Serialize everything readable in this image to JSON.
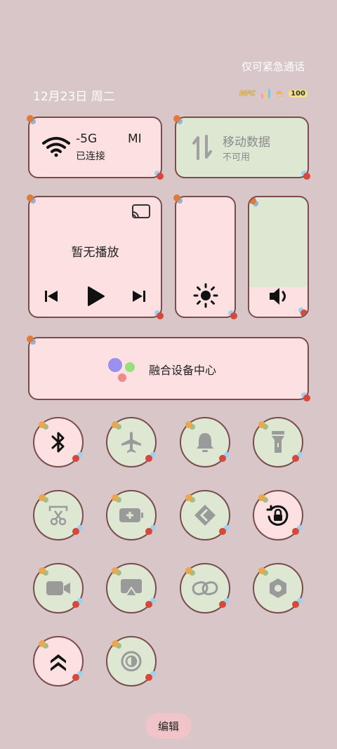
{
  "header": {
    "emergency_note": "仅可紧急通话",
    "date": "12月23日 周二",
    "nfc": "NFC",
    "battery": "100"
  },
  "tiles": {
    "wifi": {
      "name_part1": "-5G",
      "name_part2": "MI",
      "status": "已连接"
    },
    "mobile_data": {
      "title": "移动数据",
      "status": "不可用"
    },
    "media": {
      "title": "暂无播放"
    },
    "device_center": {
      "label": "融合设备中心"
    }
  },
  "toggles": [
    {
      "name": "bluetooth",
      "state": "on"
    },
    {
      "name": "airplane",
      "state": "off"
    },
    {
      "name": "bell",
      "state": "off"
    },
    {
      "name": "flashlight",
      "state": "off"
    },
    {
      "name": "screenshot",
      "state": "off"
    },
    {
      "name": "battery-saver",
      "state": "off"
    },
    {
      "name": "share",
      "state": "off"
    },
    {
      "name": "rotation-lock",
      "state": "on"
    },
    {
      "name": "screen-record",
      "state": "off"
    },
    {
      "name": "cast",
      "state": "off"
    },
    {
      "name": "link",
      "state": "off"
    },
    {
      "name": "settings-hex",
      "state": "off"
    },
    {
      "name": "performance",
      "state": "on"
    },
    {
      "name": "dark-mode",
      "state": "off"
    }
  ],
  "footer": {
    "edit_label": "编辑"
  },
  "colors": {
    "background": "#d8c6c8",
    "pink_tile": "#fde0e2",
    "green_tile": "#dde7d2",
    "border": "#7a4c4c"
  }
}
